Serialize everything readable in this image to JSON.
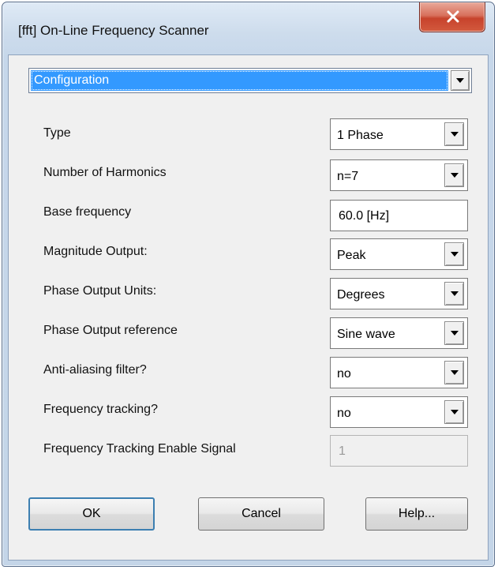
{
  "window": {
    "title": "[fft] On-Line Frequency Scanner",
    "close_icon": "close-x-icon",
    "close_color": "#c7432c"
  },
  "section_select": {
    "value": "Configuration"
  },
  "fields": {
    "type": {
      "label": "Type",
      "value": "1 Phase"
    },
    "harmonics": {
      "label": "Number of Harmonics",
      "value": "n=7"
    },
    "base_frequency": {
      "label": "Base frequency",
      "value": "60.0 [Hz]"
    },
    "magnitude_output": {
      "label": "Magnitude Output:",
      "value": "Peak"
    },
    "phase_units": {
      "label": "Phase Output Units:",
      "value": "Degrees"
    },
    "phase_reference": {
      "label": "Phase Output reference",
      "value": "Sine wave"
    },
    "anti_aliasing": {
      "label": "Anti-aliasing filter?",
      "value": "no"
    },
    "frequency_tracking": {
      "label": "Frequency tracking?",
      "value": "no"
    },
    "tracking_enable_signal": {
      "label": "Frequency Tracking Enable Signal",
      "value": "1"
    }
  },
  "buttons": {
    "ok": "OK",
    "cancel": "Cancel",
    "help": "Help..."
  },
  "colors": {
    "selection": "#3399ff",
    "default_button_border": "#3c7fb1"
  }
}
